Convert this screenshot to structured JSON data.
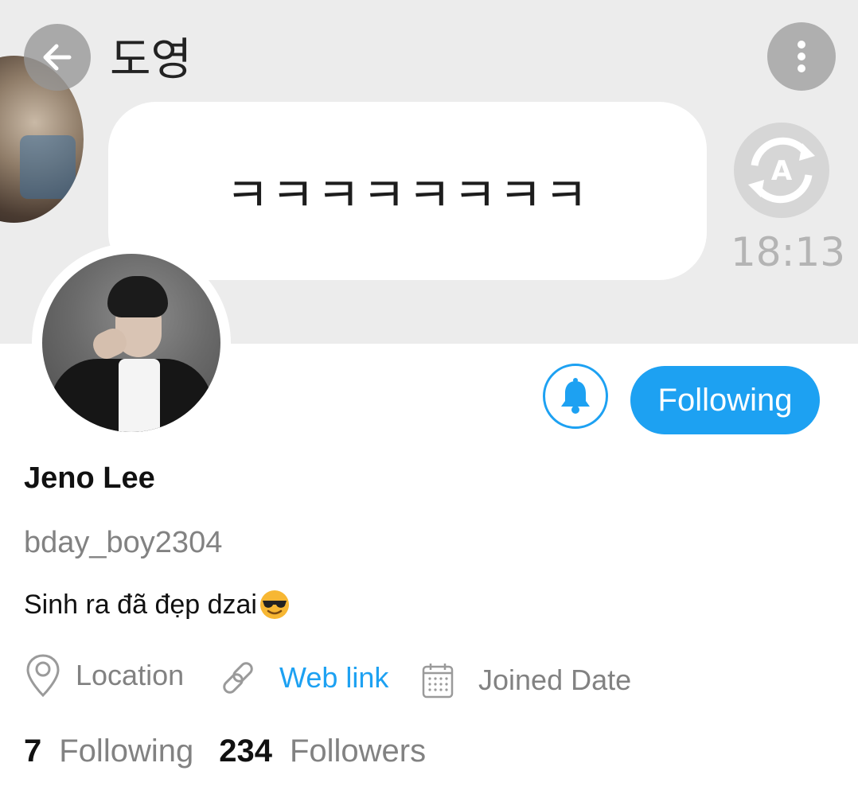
{
  "header": {
    "chat_name": "도영",
    "message_text": "ㅋㅋㅋㅋㅋㅋㅋㅋ",
    "timestamp": "18:13"
  },
  "actions": {
    "following_label": "Following"
  },
  "profile": {
    "display_name": "Jeno Lee",
    "username": "bday_boy2304",
    "bio": "Sinh ra đã đẹp dzai"
  },
  "meta": {
    "location_label": "Location",
    "weblink_label": "Web link",
    "joined_label": "Joined Date"
  },
  "stats": {
    "following_count": "7",
    "following_label": "Following",
    "followers_count": "234",
    "followers_label": "Followers"
  },
  "colors": {
    "accent": "#1da1f2",
    "muted_text": "#828282",
    "header_bg": "#ececec"
  },
  "icons": {
    "back": "arrow-left-icon",
    "more": "more-vertical-icon",
    "bell": "bell-icon",
    "location": "map-pin-icon",
    "weblink": "link-icon",
    "joined": "calendar-icon",
    "emoji": "sunglasses-emoji"
  }
}
